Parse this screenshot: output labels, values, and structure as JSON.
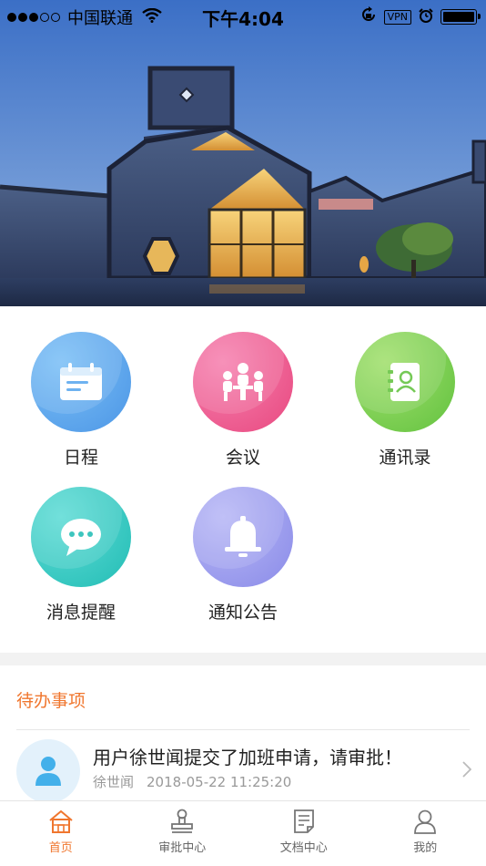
{
  "status_bar": {
    "carrier": "中国联通",
    "time": "下午4:04",
    "vpn": "VPN",
    "signal_bars_filled": 3,
    "signal_bars_total": 5,
    "battery_level": 1.0
  },
  "grid": {
    "items": [
      {
        "label": "日程",
        "icon": "calendar-icon",
        "color": "#5aa8ee"
      },
      {
        "label": "会议",
        "icon": "meeting-icon",
        "color": "#ee5e95"
      },
      {
        "label": "通讯录",
        "icon": "contacts-book-icon",
        "color": "#7fd15a"
      },
      {
        "label": "消息提醒",
        "icon": "chat-bubble-icon",
        "color": "#37c9c3"
      },
      {
        "label": "通知公告",
        "icon": "bell-icon",
        "color": "#9d9ef0"
      }
    ]
  },
  "todo": {
    "title": "待办事项",
    "items": [
      {
        "text": "用户徐世闻提交了加班申请，请审批！",
        "user": "徐世闻",
        "time": "2018-05-22 11:25:20"
      }
    ]
  },
  "tabbar": {
    "tabs": [
      {
        "label": "首页",
        "icon": "home-icon",
        "active": true
      },
      {
        "label": "审批中心",
        "icon": "stamp-icon",
        "active": false
      },
      {
        "label": "文档中心",
        "icon": "document-icon",
        "active": false
      },
      {
        "label": "我的",
        "icon": "user-icon",
        "active": false
      }
    ]
  },
  "colors": {
    "accent": "#f0762e",
    "separator": "#f2f2f2"
  }
}
